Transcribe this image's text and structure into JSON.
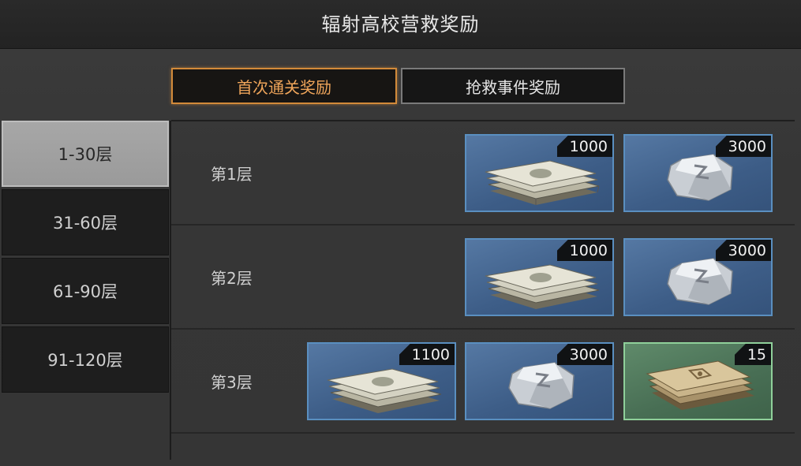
{
  "title": "辐射高校营救奖励",
  "tabs": [
    {
      "label": "首次通关奖励",
      "active": true
    },
    {
      "label": "抢救事件奖励",
      "active": false
    }
  ],
  "floor_ranges": [
    {
      "label": "1-30层",
      "active": true
    },
    {
      "label": "31-60层",
      "active": false
    },
    {
      "label": "61-90层",
      "active": false
    },
    {
      "label": "91-120层",
      "active": false
    }
  ],
  "rows": [
    {
      "label": "第1层",
      "rewards": [
        {
          "icon": "cash-stack-icon",
          "quantity": "1000"
        },
        {
          "icon": "crystal-icon",
          "quantity": "3000"
        }
      ]
    },
    {
      "label": "第2层",
      "rewards": [
        {
          "icon": "cash-stack-icon",
          "quantity": "1000"
        },
        {
          "icon": "crystal-icon",
          "quantity": "3000"
        }
      ]
    },
    {
      "label": "第3层",
      "rewards": [
        {
          "icon": "cash-stack-icon",
          "quantity": "1100"
        },
        {
          "icon": "crystal-icon",
          "quantity": "3000"
        },
        {
          "icon": "card-stack-icon",
          "quantity": "15"
        }
      ]
    }
  ],
  "colors": {
    "accent": "#d28a3a",
    "card_blue": "#3d5d87",
    "card_green": "#486e54"
  }
}
